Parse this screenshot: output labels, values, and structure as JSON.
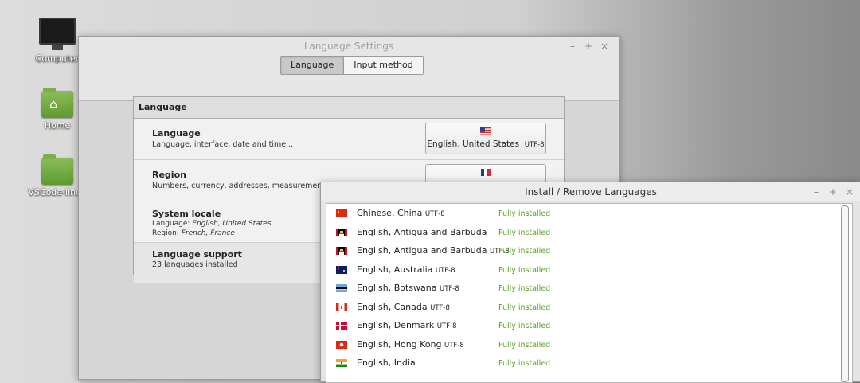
{
  "desktop": {
    "icons": [
      {
        "label": "Computer"
      },
      {
        "label": "Home"
      },
      {
        "label": "VSCode-linux"
      }
    ]
  },
  "language_settings": {
    "title": "Language Settings",
    "controls": {
      "minimize": "–",
      "maximize": "+",
      "close": "×"
    },
    "tabs": [
      {
        "label": "Language",
        "active": true
      },
      {
        "label": "Input method",
        "active": false
      }
    ],
    "section_title": "Language",
    "rows": {
      "language": {
        "title": "Language",
        "subtitle": "Language, interface, date and time...",
        "button_label": "English, United States",
        "button_encoding": "UTF-8",
        "flag": "us-flag-icon"
      },
      "region": {
        "title": "Region",
        "subtitle": "Numbers, currency, addresses, measurement...",
        "flag": "france-flag-icon"
      },
      "system_locale": {
        "title": "System locale",
        "language_prefix": "Language: ",
        "language_value": "English, United States",
        "region_prefix": "Region: ",
        "region_value": "French, France"
      },
      "language_support": {
        "title": "Language support",
        "subtitle": "23 languages installed"
      }
    }
  },
  "install_remove": {
    "title": "Install / Remove Languages",
    "controls": {
      "minimize": "–",
      "maximize": "+",
      "close": "×"
    },
    "languages": [
      {
        "name": "Chinese, China",
        "encoding": "UTF-8",
        "status": "Fully installed",
        "flag": "china-flag-icon"
      },
      {
        "name": "English, Antigua and Barbuda",
        "encoding": "",
        "status": "Fully installed",
        "flag": "antigua-flag-icon"
      },
      {
        "name": "English, Antigua and Barbuda",
        "encoding": "UTF-8",
        "status": "Fully installed",
        "flag": "antigua-flag-icon"
      },
      {
        "name": "English, Australia",
        "encoding": "UTF-8",
        "status": "Fully installed",
        "flag": "australia-flag-icon"
      },
      {
        "name": "English, Botswana",
        "encoding": "UTF-8",
        "status": "Fully installed",
        "flag": "botswana-flag-icon"
      },
      {
        "name": "English, Canada",
        "encoding": "UTF-8",
        "status": "Fully installed",
        "flag": "canada-flag-icon"
      },
      {
        "name": "English, Denmark",
        "encoding": "UTF-8",
        "status": "Fully installed",
        "flag": "denmark-flag-icon"
      },
      {
        "name": "English, Hong Kong",
        "encoding": "UTF-8",
        "status": "Fully installed",
        "flag": "hong-kong-flag-icon"
      },
      {
        "name": "English, India",
        "encoding": "",
        "status": "Fully installed",
        "flag": "india-flag-icon"
      }
    ]
  }
}
